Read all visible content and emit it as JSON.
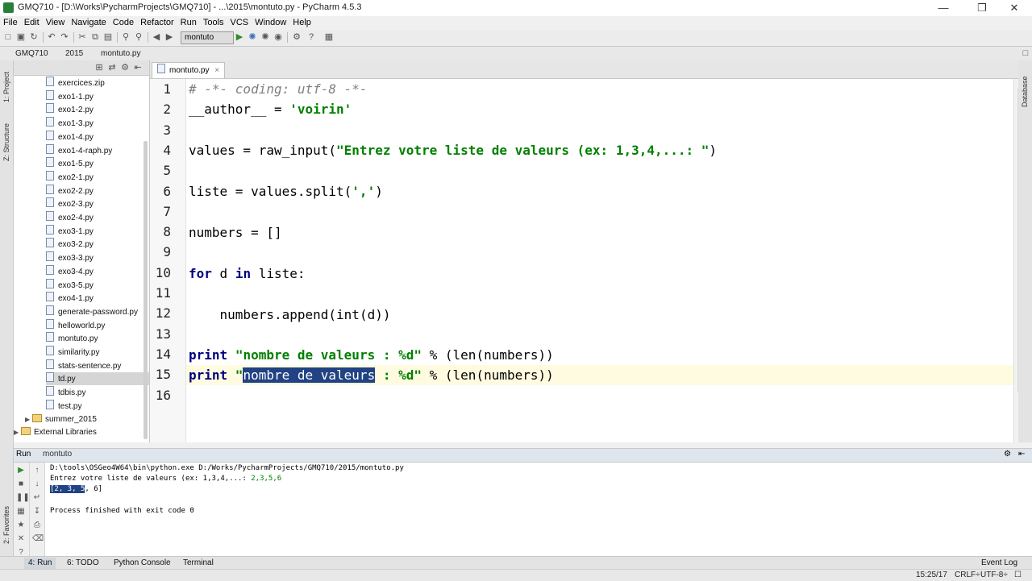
{
  "window": {
    "title": "GMQ710 - [D:\\Works\\PycharmProjects\\GMQ710] - ...\\2015\\montuto.py - PyCharm 4.5.3",
    "minimize": "—",
    "maximize": "❐",
    "close": "✕"
  },
  "menu": [
    "File",
    "Edit",
    "View",
    "Navigate",
    "Code",
    "Refactor",
    "Run",
    "Tools",
    "VCS",
    "Window",
    "Help"
  ],
  "toolbar": {
    "run_config": "montuto"
  },
  "breadcrumb": [
    "GMQ710",
    "2015",
    "montuto.py"
  ],
  "left_stripe": {
    "project": "1: Project",
    "structure": "Z: Structure",
    "favorites": "2: Favorites"
  },
  "right_stripe": {
    "database": "Database"
  },
  "project_tree": {
    "items": [
      {
        "label": "exercices.zip",
        "kind": "file"
      },
      {
        "label": "exo1-1.py",
        "kind": "file"
      },
      {
        "label": "exo1-2.py",
        "kind": "file"
      },
      {
        "label": "exo1-3.py",
        "kind": "file"
      },
      {
        "label": "exo1-4.py",
        "kind": "file"
      },
      {
        "label": "exo1-4-raph.py",
        "kind": "file"
      },
      {
        "label": "exo1-5.py",
        "kind": "file"
      },
      {
        "label": "exo2-1.py",
        "kind": "file"
      },
      {
        "label": "exo2-2.py",
        "kind": "file"
      },
      {
        "label": "exo2-3.py",
        "kind": "file"
      },
      {
        "label": "exo2-4.py",
        "kind": "file"
      },
      {
        "label": "exo3-1.py",
        "kind": "file"
      },
      {
        "label": "exo3-2.py",
        "kind": "file"
      },
      {
        "label": "exo3-3.py",
        "kind": "file"
      },
      {
        "label": "exo3-4.py",
        "kind": "file"
      },
      {
        "label": "exo3-5.py",
        "kind": "file"
      },
      {
        "label": "exo4-1.py",
        "kind": "file"
      },
      {
        "label": "generate-password.py",
        "kind": "file"
      },
      {
        "label": "helloworld.py",
        "kind": "file"
      },
      {
        "label": "montuto.py",
        "kind": "file"
      },
      {
        "label": "similarity.py",
        "kind": "file"
      },
      {
        "label": "stats-sentence.py",
        "kind": "file"
      },
      {
        "label": "td.py",
        "kind": "file"
      },
      {
        "label": "tdbis.py",
        "kind": "file"
      },
      {
        "label": "test.py",
        "kind": "file"
      },
      {
        "label": "summer_2015",
        "kind": "folder"
      },
      {
        "label": "External Libraries",
        "kind": "library"
      }
    ]
  },
  "editor": {
    "tab": "montuto.py",
    "line_numbers": [
      "1",
      "2",
      "3",
      "4",
      "5",
      "6",
      "7",
      "8",
      "9",
      "10",
      "11",
      "12",
      "13",
      "14",
      "15",
      "16"
    ],
    "code": {
      "l1": "# -*- coding: utf-8 -*-",
      "l2a": "__author__ = ",
      "l2b": "'voirin'",
      "l4a": "values = raw_input(",
      "l4b": "\"Entrez votre liste de valeurs (ex: 1,3,4,...: \"",
      "l4c": ")",
      "l6a": "liste = values.split(",
      "l6b": "','",
      "l6c": ")",
      "l8": "numbers = []",
      "l10a": "for",
      "l10b": " d ",
      "l10c": "in",
      "l10d": " liste:",
      "l12a": "    numbers.append(",
      "l12b": "int",
      "l12c": "(d))",
      "l14a": "print",
      "l14b": " ",
      "l14c": "\"nombre de valeurs : %d\"",
      "l14d": " % (",
      "l14e": "len",
      "l14f": "(numbers))",
      "l15a": "print",
      "l15b": " \"",
      "l15sel": "nombre de valeurs",
      "l15c": " : %d\"",
      "l15d": " % (",
      "l15e": "len",
      "l15f": "(numbers))"
    }
  },
  "run_panel": {
    "title": "Run",
    "config": "montuto",
    "lines": {
      "cmd": "D:\\tools\\OSGeo4W64\\bin\\python.exe D:/Works/PycharmProjects/GMQ710/2015/montuto.py",
      "prompt": "Entrez votre liste de valeurs (ex: 1,3,4,...: ",
      "input": "2,3,5,6",
      "out_sel": "[2, 3, 5",
      "out_rest": ", 6]",
      "finish": "Process finished with exit code 0"
    }
  },
  "tool_windows": [
    "4: Run",
    "6: TODO",
    "Python Console",
    "Terminal"
  ],
  "event_log": "Event Log",
  "status": {
    "time": "15:25/17",
    "line_sep": "CRLF÷",
    "encoding": "UTF-8÷"
  }
}
